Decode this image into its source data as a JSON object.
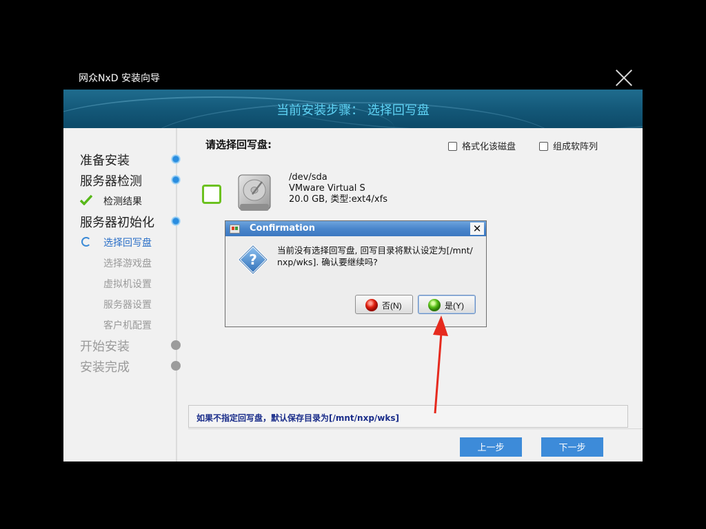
{
  "window": {
    "title": "网众NxD 安装向导"
  },
  "banner": {
    "text": "当前安装步骤： 选择回写盘"
  },
  "sidebar": {
    "steps": [
      {
        "label": "准备安装"
      },
      {
        "label": "服务器检测"
      },
      {
        "label": "检测结果"
      },
      {
        "label": "服务器初始化"
      },
      {
        "label": "选择回写盘"
      },
      {
        "label": "选择游戏盘"
      },
      {
        "label": "虚拟机设置"
      },
      {
        "label": "服务器设置"
      },
      {
        "label": "客户机配置"
      },
      {
        "label": "开始安装"
      },
      {
        "label": "安装完成"
      }
    ]
  },
  "main": {
    "title": "请选择回写盘:",
    "options": [
      {
        "label": "格式化该磁盘",
        "checked": false
      },
      {
        "label": "组成软阵列",
        "checked": false
      }
    ],
    "disk": {
      "device": "/dev/sda",
      "model": "VMware Virtual S",
      "info": "20.0 GB, 类型:ext4/xfs",
      "selected": false
    },
    "hint": "如果不指定回写盘，默认保存目录为[/mnt/nxp/wks]",
    "buttons": {
      "prev": "上一步",
      "next": "下一步"
    }
  },
  "dialog": {
    "title": "Confirmation",
    "message_line1": "当前没有选择回写盘, 回写目录将默认设定为[/mnt/",
    "message_line2": "nxp/wks]. 确认要继续吗?",
    "no_label": "否(N)",
    "yes_label": "是(Y)"
  },
  "colors": {
    "banner": "#135777",
    "banner_text": "#5fd3f5",
    "accent_button": "#3d8bd9",
    "active_step": "#2a6fc7",
    "arrow": "#e62a1e"
  }
}
